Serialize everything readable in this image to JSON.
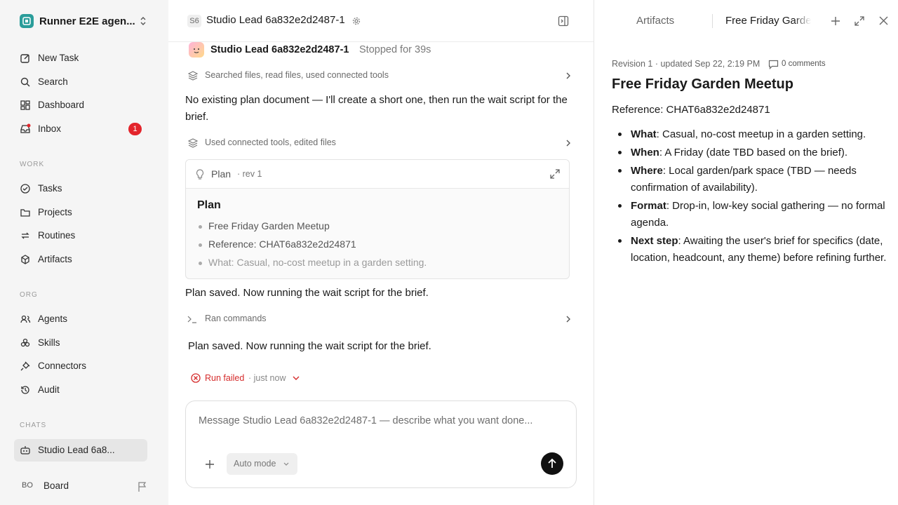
{
  "sidebar": {
    "workspace": "Runner E2E agen...",
    "nav": [
      {
        "label": "New Task"
      },
      {
        "label": "Search"
      },
      {
        "label": "Dashboard"
      },
      {
        "label": "Inbox",
        "badge": "1"
      }
    ],
    "work_heading": "WORK",
    "work": [
      {
        "label": "Tasks"
      },
      {
        "label": "Projects"
      },
      {
        "label": "Routines"
      },
      {
        "label": "Artifacts"
      }
    ],
    "org_heading": "ORG",
    "org": [
      {
        "label": "Agents"
      },
      {
        "label": "Skills"
      },
      {
        "label": "Connectors"
      },
      {
        "label": "Audit"
      }
    ],
    "chats_heading": "CHATS",
    "chat_item": "Studio Lead 6a8...",
    "user_initials": "BO",
    "user_name": "Board"
  },
  "center": {
    "badge": "S6",
    "title": "Studio Lead 6a832e2d2487-1",
    "agent_name": "Studio Lead 6a832e2d2487-1",
    "status": "Stopped for 39s",
    "tool1": "Searched files, read files, used connected tools",
    "msg1": "No existing plan document — I'll create a short one, then run the wait script for the brief.",
    "tool2": "Used connected tools, edited files",
    "plan": {
      "label": "Plan",
      "rev": "· rev 1",
      "heading": "Plan",
      "items": [
        "Free Friday Garden Meetup",
        "Reference: CHAT6a832e2d24871",
        "What: Casual, no-cost meetup in a garden setting."
      ]
    },
    "msg2": "Plan saved. Now running the wait script for the brief.",
    "tool3": "Ran commands",
    "msg3": "Plan saved. Now running the wait script for the brief.",
    "run_status": "Run failed",
    "run_time": "· just now",
    "composer": {
      "placeholder": "Message Studio Lead 6a832e2d2487-1 — describe what you want done...",
      "mode": "Auto mode"
    }
  },
  "right": {
    "tab_artifacts": "Artifacts",
    "tab_active": "Free Friday Garden Meetup",
    "meta": "Revision 1 · updated Sep 22, 2:19 PM",
    "comments": "0 comments",
    "title": "Free Friday Garden Meetup",
    "reference": "Reference: CHAT6a832e2d24871",
    "items": [
      {
        "key": "What",
        "text": ": Casual, no-cost meetup in a garden setting."
      },
      {
        "key": "When",
        "text": ": A Friday (date TBD based on the brief)."
      },
      {
        "key": "Where",
        "text": ": Local garden/park space (TBD — needs confirmation of availability)."
      },
      {
        "key": "Format",
        "text": ": Drop-in, low-key social gathering — no formal agenda."
      },
      {
        "key": "Next step",
        "text": ": Awaiting the user's brief for specifics (date, location, headcount, any theme) before refining further."
      }
    ]
  },
  "colors": {
    "accent": "#2a9d9a",
    "danger": "#d52b2b",
    "badge": "#e3242b"
  }
}
